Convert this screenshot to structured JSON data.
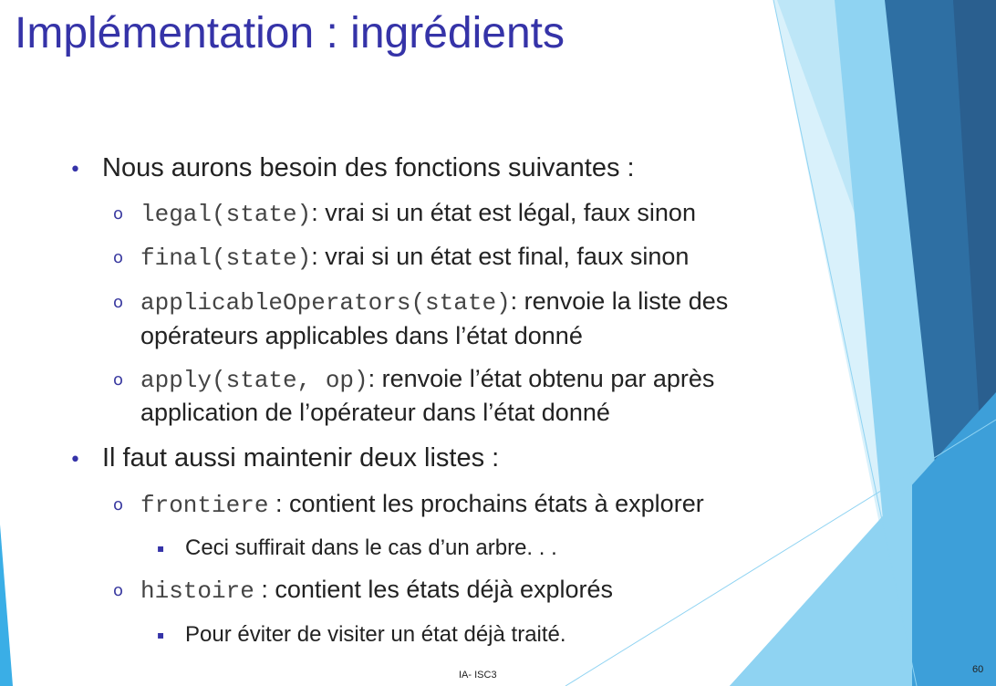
{
  "slide": {
    "title": "Implémentation : ingrédients",
    "bullets": [
      {
        "text": "Nous aurons besoin des fonctions suivantes :",
        "subitems": [
          {
            "code": "legal(state)",
            "desc": ": vrai si un état est légal, faux sinon"
          },
          {
            "code": "final(state)",
            "desc": ": vrai si un état est final, faux sinon"
          },
          {
            "code": "applicableOperators(state)",
            "desc": ": renvoie la liste des",
            "desc_line2": "opérateurs applicables dans l’état donné"
          },
          {
            "code": "apply(state, op)",
            "desc": ": renvoie l’état obtenu par après",
            "desc_line2": "application de l’opérateur dans l’état donné"
          }
        ]
      },
      {
        "text": "Il faut aussi maintenir deux listes :",
        "subitems": [
          {
            "code": "frontiere",
            "desc": " : contient les prochains états à explorer",
            "note": "Ceci suffirait dans le cas d’un arbre. . ."
          },
          {
            "code": "histoire",
            "desc": " : contient les états déjà explorés",
            "note": "Pour éviter de visiter un état déjà traité."
          }
        ]
      }
    ],
    "markers": {
      "level1": "•",
      "level2": "o",
      "level3": "▪"
    },
    "footer": {
      "center": "IA- ISC3",
      "page_number": "60"
    },
    "colors": {
      "title": "#3533a8",
      "text": "#222222",
      "code": "#444444",
      "deco_dark": "#2e6fa3",
      "deco_mid": "#3d9fd9",
      "deco_light": "#8fd3f2"
    }
  }
}
